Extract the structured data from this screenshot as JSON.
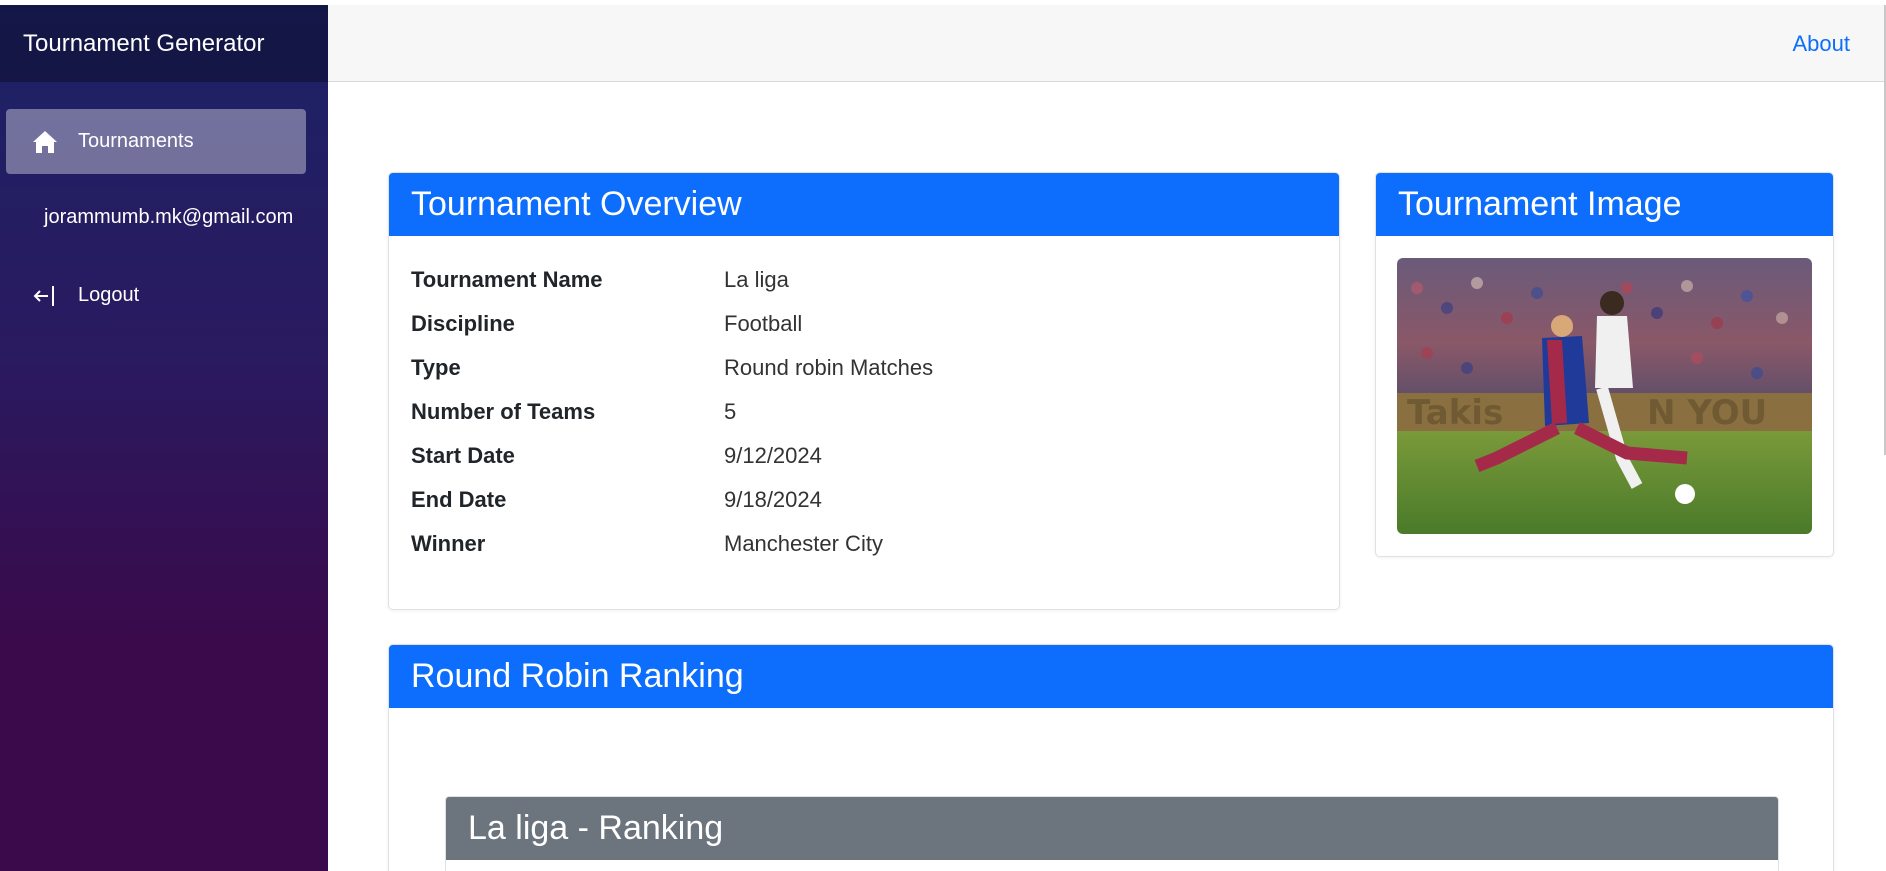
{
  "app": {
    "title": "Tournament Generator"
  },
  "sidebar": {
    "items": [
      {
        "label": "Tournaments",
        "icon": "home-icon",
        "active": true
      },
      {
        "label": "Logout",
        "icon": "logout-icon"
      }
    ],
    "user_email": "jorammumb.mk@gmail.com"
  },
  "topbar": {
    "about_label": "About"
  },
  "overview": {
    "title": "Tournament Overview",
    "rows": [
      {
        "label": "Tournament Name",
        "value": "La liga"
      },
      {
        "label": "Discipline",
        "value": "Football"
      },
      {
        "label": "Type",
        "value": "Round robin Matches"
      },
      {
        "label": "Number of Teams",
        "value": "5"
      },
      {
        "label": "Start Date",
        "value": "9/12/2024"
      },
      {
        "label": "End Date",
        "value": "9/18/2024"
      },
      {
        "label": "Winner",
        "value": "Manchester City"
      }
    ]
  },
  "image_card": {
    "title": "Tournament Image"
  },
  "ranking": {
    "title": "Round Robin Ranking",
    "sub_title": "La liga - Ranking"
  },
  "colors": {
    "primary": "#0d6efd",
    "secondary": "#6c757d",
    "sidebar_top": "#1c2266",
    "sidebar_bottom": "#3b0a4a"
  }
}
